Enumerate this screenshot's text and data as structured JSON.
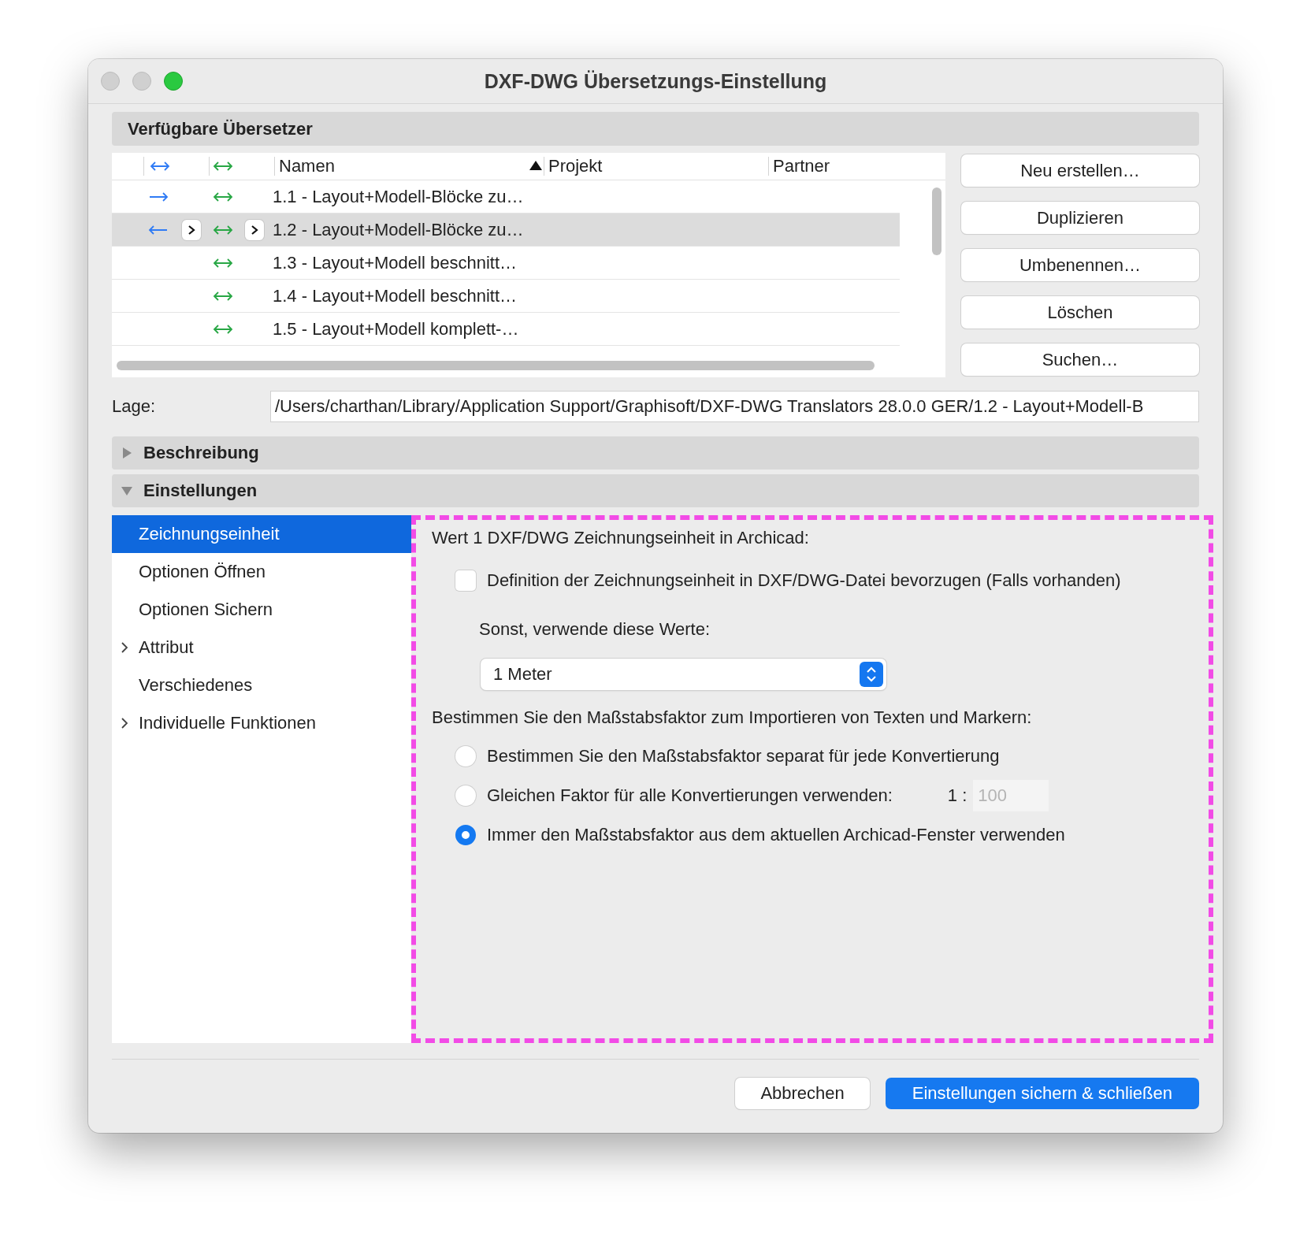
{
  "window": {
    "title": "DXF-DWG Übersetzungs-Einstellung"
  },
  "translators": {
    "title": "Verfügbare Übersetzer",
    "columns": [
      {
        "label": "Namen",
        "sorted": true
      },
      {
        "label": "Projekt",
        "sorted": false
      },
      {
        "label": "Partner",
        "sorted": false
      }
    ],
    "rows": [
      {
        "name": "1.1 - Layout+Modell-Blöcke zu…",
        "arrow_right": true,
        "arrow_left": false,
        "selected": false
      },
      {
        "name": "1.2 - Layout+Modell-Blöcke zu…",
        "arrow_right": false,
        "arrow_left": true,
        "selected": true
      },
      {
        "name": "1.3 - Layout+Modell beschnitt…",
        "arrow_right": false,
        "arrow_left": false,
        "selected": false
      },
      {
        "name": "1.4 - Layout+Modell beschnitt…",
        "arrow_right": false,
        "arrow_left": false,
        "selected": false
      },
      {
        "name": "1.5 - Layout+Modell komplett-…",
        "arrow_right": false,
        "arrow_left": false,
        "selected": false
      }
    ],
    "buttons": [
      "Neu erstellen…",
      "Duplizieren",
      "Umbenennen…",
      "Löschen",
      "Suchen…"
    ]
  },
  "location": {
    "label": "Lage:",
    "value": "/Users/charthan/Library/Application Support/Graphisoft/DXF-DWG Translators 28.0.0 GER/1.2 - Layout+Modell-B"
  },
  "sections": [
    {
      "title": "Beschreibung",
      "expanded": false
    },
    {
      "title": "Einstellungen",
      "expanded": true
    }
  ],
  "settings": {
    "nav": [
      {
        "label": "Zeichnungseinheit",
        "selected": true,
        "expandable": false
      },
      {
        "label": "Optionen Öffnen",
        "selected": false,
        "expandable": false
      },
      {
        "label": "Optionen Sichern",
        "selected": false,
        "expandable": false
      },
      {
        "label": "Attribut",
        "selected": false,
        "expandable": true
      },
      {
        "label": "Verschiedenes",
        "selected": false,
        "expandable": false
      },
      {
        "label": "Individuelle Funktionen",
        "selected": false,
        "expandable": true
      }
    ],
    "highlighted": true,
    "unit_heading": "Wert 1 DXF/DWG Zeichnungseinheit in Archicad:",
    "prefer_checkbox": {
      "label": "Definition der Zeichnungseinheit in DXF/DWG-Datei bevorzugen (Falls vorhanden)",
      "checked": false
    },
    "fallback_label": "Sonst, verwende diese Werte:",
    "unit_select": {
      "value": "1 Meter"
    },
    "scale_heading": "Bestimmen Sie den Maßstabsfaktor zum Importieren von Texten und Markern:",
    "scale_options": [
      {
        "label": "Bestimmen Sie den Maßstabsfaktor separat für jede Konvertierung",
        "selected": false
      },
      {
        "label": "Gleichen Faktor für alle Konvertierungen verwenden:",
        "selected": false,
        "ratio_prefix": "1 :",
        "ratio_value": "100",
        "ratio_disabled": true
      },
      {
        "label": "Immer den Maßstabsfaktor aus dem aktuellen Archicad-Fenster verwenden",
        "selected": true
      }
    ]
  },
  "footer_buttons": [
    {
      "label": "Abbrechen",
      "primary": false
    },
    {
      "label": "Einstellungen sichern & schließen",
      "primary": true
    }
  ]
}
